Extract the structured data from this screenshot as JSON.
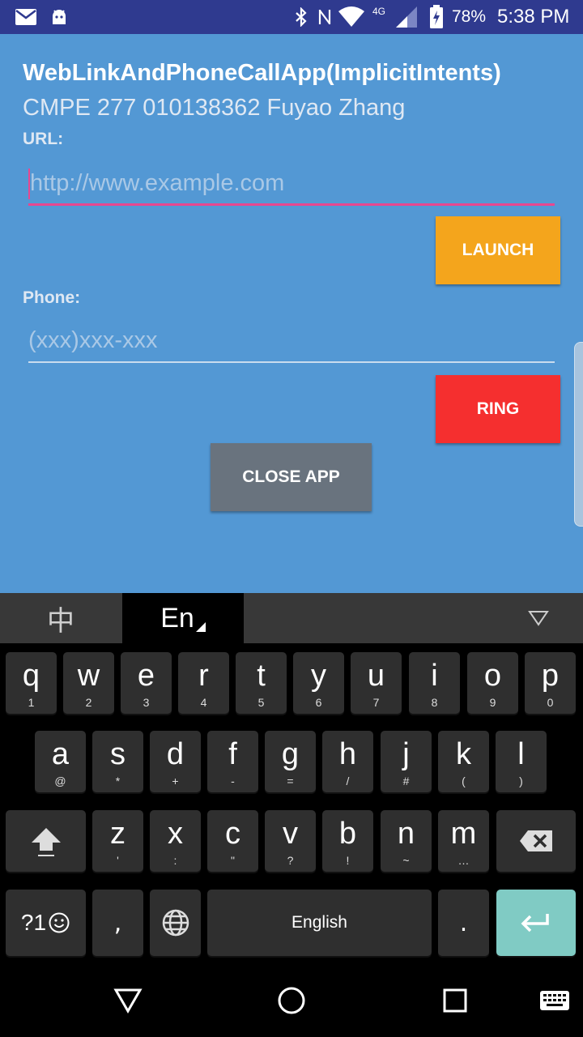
{
  "status_bar": {
    "battery_percent": "78%",
    "time": "5:38 PM",
    "network_type": "4G",
    "icons": [
      "mail-icon",
      "android-debug-icon",
      "bluetooth-icon",
      "nfc-icon",
      "wifi-icon",
      "cell-signal-icon",
      "battery-charging-icon"
    ]
  },
  "app": {
    "title": "WebLinkAndPhoneCallApp(ImplicitIntents)",
    "subtitle": "CMPE 277 010138362 Fuyao Zhang",
    "url_label": "URL:",
    "url_placeholder": "http://www.example.com",
    "url_value": "",
    "launch_button": "LAUNCH",
    "phone_label": "Phone:",
    "phone_placeholder": "(xxx)xxx-xxx",
    "phone_value": "",
    "ring_button": "RING",
    "close_button": "CLOSE APP",
    "colors": {
      "background": "#5398d4",
      "launch": "#f4a51c",
      "ring": "#f52f2f",
      "close": "#69737e",
      "focus_underline": "#e8478f"
    }
  },
  "keyboard": {
    "mode_tabs": [
      "中",
      "En"
    ],
    "active_mode": "En",
    "collapse_icon": "triangle-down-icon",
    "rows": [
      [
        {
          "main": "q",
          "sub": "1"
        },
        {
          "main": "w",
          "sub": "2"
        },
        {
          "main": "e",
          "sub": "3"
        },
        {
          "main": "r",
          "sub": "4"
        },
        {
          "main": "t",
          "sub": "5"
        },
        {
          "main": "y",
          "sub": "6"
        },
        {
          "main": "u",
          "sub": "7"
        },
        {
          "main": "i",
          "sub": "8"
        },
        {
          "main": "o",
          "sub": "9"
        },
        {
          "main": "p",
          "sub": "0"
        }
      ],
      [
        {
          "main": "a",
          "sub": "@"
        },
        {
          "main": "s",
          "sub": "*"
        },
        {
          "main": "d",
          "sub": "+"
        },
        {
          "main": "f",
          "sub": "-"
        },
        {
          "main": "g",
          "sub": "="
        },
        {
          "main": "h",
          "sub": "/"
        },
        {
          "main": "j",
          "sub": "#"
        },
        {
          "main": "k",
          "sub": "("
        },
        {
          "main": "l",
          "sub": ")"
        }
      ],
      [
        {
          "main": "z",
          "sub": "'"
        },
        {
          "main": "x",
          "sub": ":"
        },
        {
          "main": "c",
          "sub": "\""
        },
        {
          "main": "v",
          "sub": "?"
        },
        {
          "main": "b",
          "sub": "!"
        },
        {
          "main": "n",
          "sub": "~"
        },
        {
          "main": "m",
          "sub": "…"
        }
      ]
    ],
    "symbols_key": "?1",
    "comma_key": ",",
    "space_label": "English",
    "period_key": ".",
    "enter_color": "#80cbc4"
  },
  "nav_bar": {
    "buttons": [
      "back-icon",
      "home-icon",
      "recents-icon",
      "keyboard-switch-icon"
    ]
  }
}
